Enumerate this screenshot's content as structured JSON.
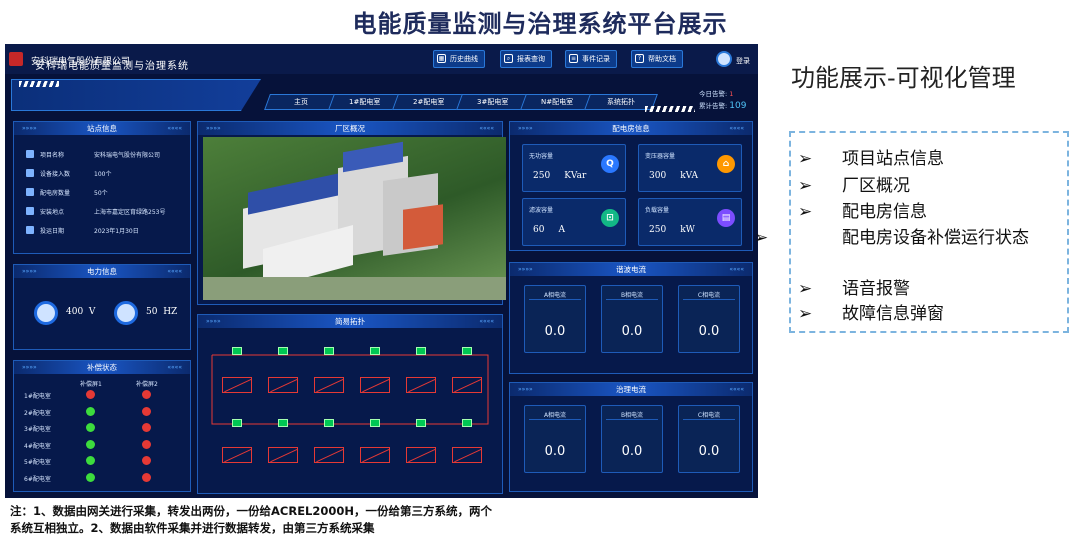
{
  "slide_title": "电能质量监测与治理系统平台展示",
  "dashboard": {
    "company": "安科瑞电气股份有限公司",
    "nav_buttons": [
      "历史曲线",
      "报表查询",
      "事件记录",
      "帮助文档"
    ],
    "login": "登录",
    "system_title": "安科瑞电能质量监测与治理系统",
    "tabs": [
      "主页",
      "1#配电室",
      "2#配电室",
      "3#配电室",
      "N#配电室",
      "系统拓扑"
    ],
    "alarm_today_label": "今日告警:",
    "alarm_today_value": "1",
    "alarm_total_label": "累计告警:",
    "alarm_total_value": "109",
    "site_info": {
      "title": "站点信息",
      "rows": [
        {
          "label": "项目名称",
          "value": "安科瑞电气股份有限公司"
        },
        {
          "label": "设备接入数",
          "value": "100个"
        },
        {
          "label": "配电房数量",
          "value": "50个"
        },
        {
          "label": "安装地点",
          "value": "上海市嘉定区育绿路253号"
        },
        {
          "label": "投运日期",
          "value": "2023年1月30日"
        }
      ]
    },
    "power_info": {
      "title": "电力信息",
      "voltage": "400",
      "voltage_unit": "V",
      "freq": "50",
      "freq_unit": "HZ"
    },
    "comp_status": {
      "title": "补偿状态",
      "col1": "补偿屏1",
      "col2": "补偿屏2",
      "rows": [
        "1#配电室",
        "2#配电室",
        "3#配电室",
        "4#配电室",
        "5#配电室",
        "6#配电室"
      ],
      "status1": [
        "red",
        "green",
        "green",
        "green",
        "green",
        "green"
      ],
      "status2": [
        "red",
        "red",
        "red",
        "red",
        "red",
        "red"
      ],
      "red": "#e53935",
      "green": "#3ddc3d"
    },
    "plant": {
      "title": "厂区概况"
    },
    "topology": {
      "title": "简易拓扑"
    },
    "room_info": {
      "title": "配电房信息",
      "cards": [
        {
          "label": "无功容量",
          "value": "250",
          "unit": "KVar",
          "icon": "Q",
          "color": "#2a78ff"
        },
        {
          "label": "变压器容量",
          "value": "300",
          "unit": "kVA",
          "icon": "⌂",
          "color": "#ff9800"
        },
        {
          "label": "滤波容量",
          "value": "60",
          "unit": "A",
          "icon": "⊡",
          "color": "#12b886"
        },
        {
          "label": "负载容量",
          "value": "250",
          "unit": "kW",
          "icon": "▤",
          "color": "#7c4dff"
        }
      ]
    },
    "harmonic": {
      "title": "谐波电流",
      "labels": [
        "A相电流",
        "B相电流",
        "C相电流"
      ],
      "values": [
        "0.0",
        "0.0",
        "0.0"
      ]
    },
    "governance": {
      "title": "治理电流",
      "labels": [
        "A相电流",
        "B相电流",
        "C相电流"
      ],
      "values": [
        "0.0",
        "0.0",
        "0.0"
      ]
    }
  },
  "right": {
    "title": "功能展示-可视化管理",
    "arrow": "➢",
    "items": [
      "项目站点信息",
      "厂区概况",
      "配电房信息",
      "配电房设备补偿运行状态",
      "语音报警",
      "故障信息弹窗"
    ]
  },
  "footnote_line1": "注：1、数据由网关进行采集，转发出两份，一份给ACREL2000H，一份给第三方系统，两个",
  "footnote_line2": "系统互相独立。2、数据由软件采集并进行数据转发，由第三方系统采集"
}
